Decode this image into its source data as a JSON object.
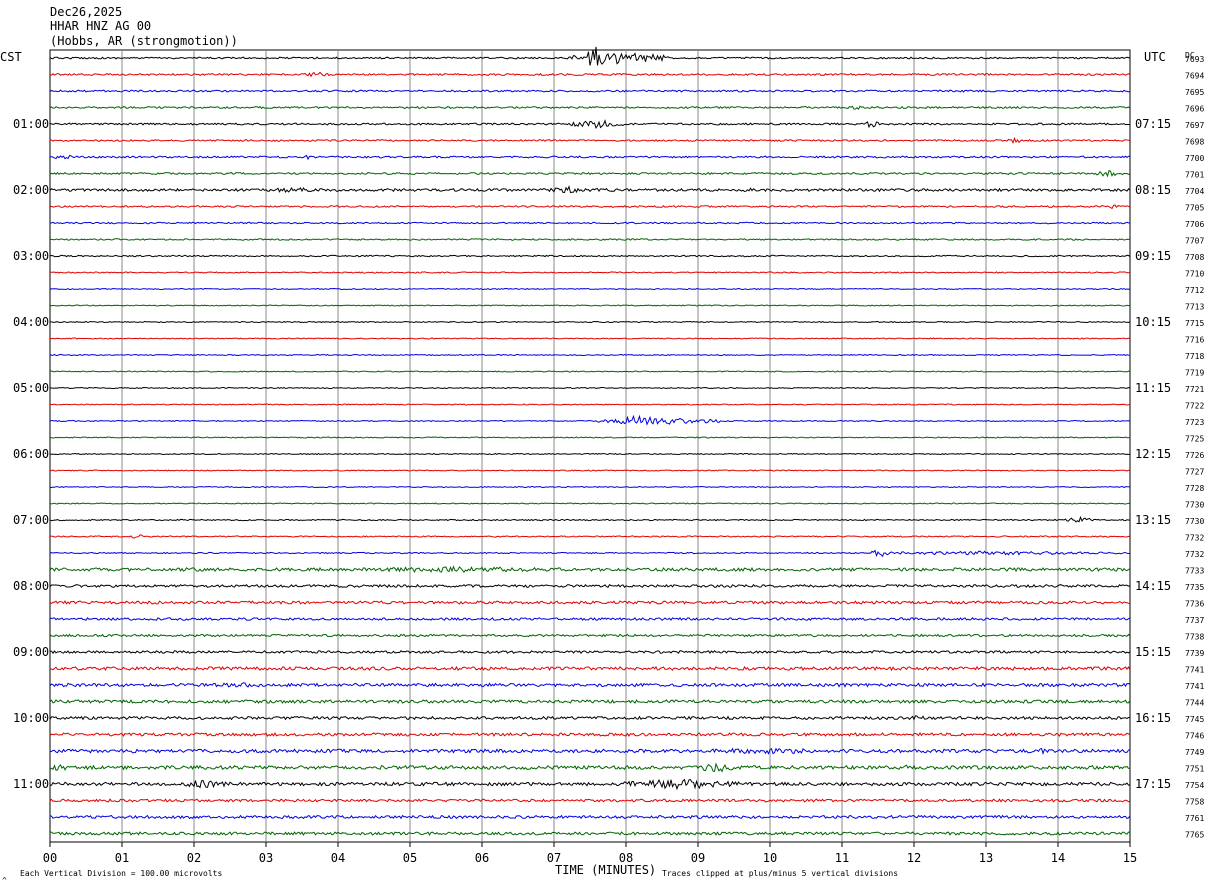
{
  "header": {
    "date": "Dec26,2025",
    "station": "HHAR HNZ AG 00",
    "location": "(Hobbs, AR (strongmotion))"
  },
  "chart_data": {
    "type": "line",
    "title": "Dec26,2025",
    "left_axis_label": "CST",
    "right_axis_label": "UTC",
    "dc_label": "DC",
    "xlabel": "TIME (MINUTES)",
    "x_ticks": [
      "00",
      "01",
      "02",
      "03",
      "04",
      "05",
      "06",
      "07",
      "08",
      "09",
      "10",
      "11",
      "12",
      "13",
      "14",
      "15"
    ],
    "xlim": [
      0,
      15
    ],
    "left_hour_labels": [
      {
        "row": 4,
        "text": "01:00"
      },
      {
        "row": 8,
        "text": "02:00"
      },
      {
        "row": 12,
        "text": "03:00"
      },
      {
        "row": 16,
        "text": "04:00"
      },
      {
        "row": 20,
        "text": "05:00"
      },
      {
        "row": 24,
        "text": "06:00"
      },
      {
        "row": 28,
        "text": "07:00"
      },
      {
        "row": 32,
        "text": "08:00"
      },
      {
        "row": 36,
        "text": "09:00"
      },
      {
        "row": 40,
        "text": "10:00"
      },
      {
        "row": 44,
        "text": "11:00"
      }
    ],
    "right_hour_labels": [
      {
        "row": 4,
        "text": "07:15"
      },
      {
        "row": 8,
        "text": "08:15"
      },
      {
        "row": 12,
        "text": "09:15"
      },
      {
        "row": 16,
        "text": "10:15"
      },
      {
        "row": 20,
        "text": "11:15"
      },
      {
        "row": 24,
        "text": "12:15"
      },
      {
        "row": 28,
        "text": "13:15"
      },
      {
        "row": 32,
        "text": "14:15"
      },
      {
        "row": 36,
        "text": "15:15"
      },
      {
        "row": 40,
        "text": "16:15"
      },
      {
        "row": 44,
        "text": "17:15"
      }
    ],
    "dc_offsets": [
      "7693",
      "7694",
      "7695",
      "7696",
      "7697",
      "7698",
      "7700",
      "7701",
      "7704",
      "7705",
      "7706",
      "7707",
      "7708",
      "7710",
      "7712",
      "7713",
      "7715",
      "7716",
      "7718",
      "7719",
      "7721",
      "7722",
      "7723",
      "7725",
      "7726",
      "7727",
      "7728",
      "7730",
      "7730",
      "7732",
      "7732",
      "7733",
      "7735",
      "7736",
      "7737",
      "7738",
      "7739",
      "7741",
      "7741",
      "7744",
      "7745",
      "7746",
      "7749",
      "7751",
      "7754",
      "7758",
      "7761",
      "7765"
    ],
    "row_colors": [
      "#000000",
      "#e00000",
      "#0000e0",
      "#006400"
    ],
    "row_noise": [
      0.8,
      0.9,
      0.9,
      0.9,
      0.9,
      0.8,
      0.9,
      0.9,
      1.3,
      0.8,
      0.7,
      0.7,
      0.7,
      0.6,
      0.5,
      0.5,
      0.5,
      0.5,
      0.5,
      0.5,
      0.5,
      0.5,
      0.5,
      0.5,
      0.5,
      0.5,
      0.5,
      0.5,
      0.6,
      0.6,
      0.6,
      1.6,
      1.3,
      1.4,
      1.2,
      1.1,
      1.2,
      1.6,
      1.6,
      1.5,
      1.4,
      1.5,
      1.7,
      1.8,
      1.6,
      1.3,
      1.4,
      1.4
    ],
    "events": [
      {
        "row": 0,
        "start": 7.2,
        "end": 8.6,
        "amp": 6
      },
      {
        "row": 0,
        "start": 7.45,
        "end": 7.7,
        "amp": 13
      },
      {
        "row": 1,
        "start": 3.5,
        "end": 3.9,
        "amp": 2.5
      },
      {
        "row": 3,
        "start": 11.1,
        "end": 11.3,
        "amp": 2.5
      },
      {
        "row": 4,
        "start": 7.2,
        "end": 8.0,
        "amp": 4
      },
      {
        "row": 4,
        "start": 11.3,
        "end": 11.5,
        "amp": 4
      },
      {
        "row": 5,
        "start": 13.3,
        "end": 13.5,
        "amp": 3
      },
      {
        "row": 6,
        "start": 0.0,
        "end": 0.3,
        "amp": 3
      },
      {
        "row": 6,
        "start": 3.5,
        "end": 3.6,
        "amp": 4
      },
      {
        "row": 7,
        "start": 14.5,
        "end": 14.9,
        "amp": 3
      },
      {
        "row": 8,
        "start": 2.9,
        "end": 3.9,
        "amp": 2.5
      },
      {
        "row": 8,
        "start": 6.8,
        "end": 7.6,
        "amp": 3.5
      },
      {
        "row": 8,
        "start": 9.6,
        "end": 9.8,
        "amp": 3
      },
      {
        "row": 9,
        "start": 14.7,
        "end": 14.8,
        "amp": 4
      },
      {
        "row": 22,
        "start": 7.6,
        "end": 9.3,
        "amp": 3.5
      },
      {
        "row": 22,
        "start": 7.9,
        "end": 8.5,
        "amp": 6
      },
      {
        "row": 28,
        "start": 14.1,
        "end": 14.5,
        "amp": 3
      },
      {
        "row": 29,
        "start": 1.1,
        "end": 1.3,
        "amp": 3
      },
      {
        "row": 30,
        "start": 11.3,
        "end": 15.0,
        "amp": 2
      },
      {
        "row": 30,
        "start": 11.4,
        "end": 11.7,
        "amp": 4
      },
      {
        "row": 31,
        "start": 3.9,
        "end": 7.4,
        "amp": 3
      },
      {
        "row": 38,
        "start": 2.0,
        "end": 3.2,
        "amp": 2.5
      },
      {
        "row": 40,
        "start": 11.9,
        "end": 12.2,
        "amp": 3
      },
      {
        "row": 42,
        "start": 8.6,
        "end": 11.2,
        "amp": 3
      },
      {
        "row": 42,
        "start": 13.6,
        "end": 13.9,
        "amp": 3
      },
      {
        "row": 43,
        "start": 0.0,
        "end": 0.3,
        "amp": 4
      },
      {
        "row": 43,
        "start": 9.0,
        "end": 9.5,
        "amp": 5
      },
      {
        "row": 43,
        "start": 11.6,
        "end": 12.2,
        "amp": 3
      },
      {
        "row": 44,
        "start": 1.8,
        "end": 2.5,
        "amp": 5
      },
      {
        "row": 44,
        "start": 7.9,
        "end": 9.6,
        "amp": 5
      },
      {
        "row": 47,
        "start": 0.0,
        "end": 15.0,
        "amp": 1
      }
    ]
  },
  "footer": {
    "scale_note": "Each Vertical Division =  100.00 microvolts",
    "clip_note": "Traces clipped at plus/minus 5 vertical divisions",
    "corner_mark": "^"
  }
}
